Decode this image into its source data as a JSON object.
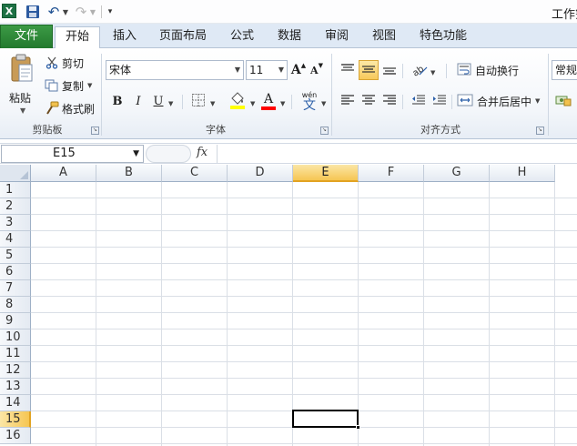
{
  "titlebar": {
    "app_icon": "X",
    "window_title": "工作簿"
  },
  "tabs": {
    "file": "文件",
    "home": "开始",
    "insert": "插入",
    "page_layout": "页面布局",
    "formulas": "公式",
    "data": "数据",
    "review": "审阅",
    "view": "视图",
    "features": "特色功能"
  },
  "ribbon": {
    "clipboard": {
      "paste": "粘贴",
      "cut": "剪切",
      "copy": "复制",
      "format_painter": "格式刷",
      "group_label": "剪贴板"
    },
    "font": {
      "font_name": "宋体",
      "font_size": "11",
      "grow_font": "A",
      "shrink_font": "A",
      "bold": "B",
      "italic": "I",
      "underline": "U",
      "font_color_letter": "A",
      "phonetic": "wén",
      "phonetic_char": "文",
      "group_label": "字体"
    },
    "alignment": {
      "wrap_text": "自动换行",
      "merge_center": "合并后居中",
      "group_label": "对齐方式"
    },
    "number": {
      "format": "常规"
    }
  },
  "formula_bar": {
    "name_box": "E15",
    "fx": "fx"
  },
  "grid": {
    "columns": [
      "A",
      "B",
      "C",
      "D",
      "E",
      "F",
      "G",
      "H"
    ],
    "rows": [
      "1",
      "2",
      "3",
      "4",
      "5",
      "6",
      "7",
      "8",
      "9",
      "10",
      "11",
      "12",
      "13",
      "14",
      "15",
      "16"
    ],
    "active_column": "E",
    "active_row": "15"
  },
  "colors": {
    "accent": "#1e7145",
    "file_tab": "#2e8b38",
    "header_active": "#f6c653"
  }
}
